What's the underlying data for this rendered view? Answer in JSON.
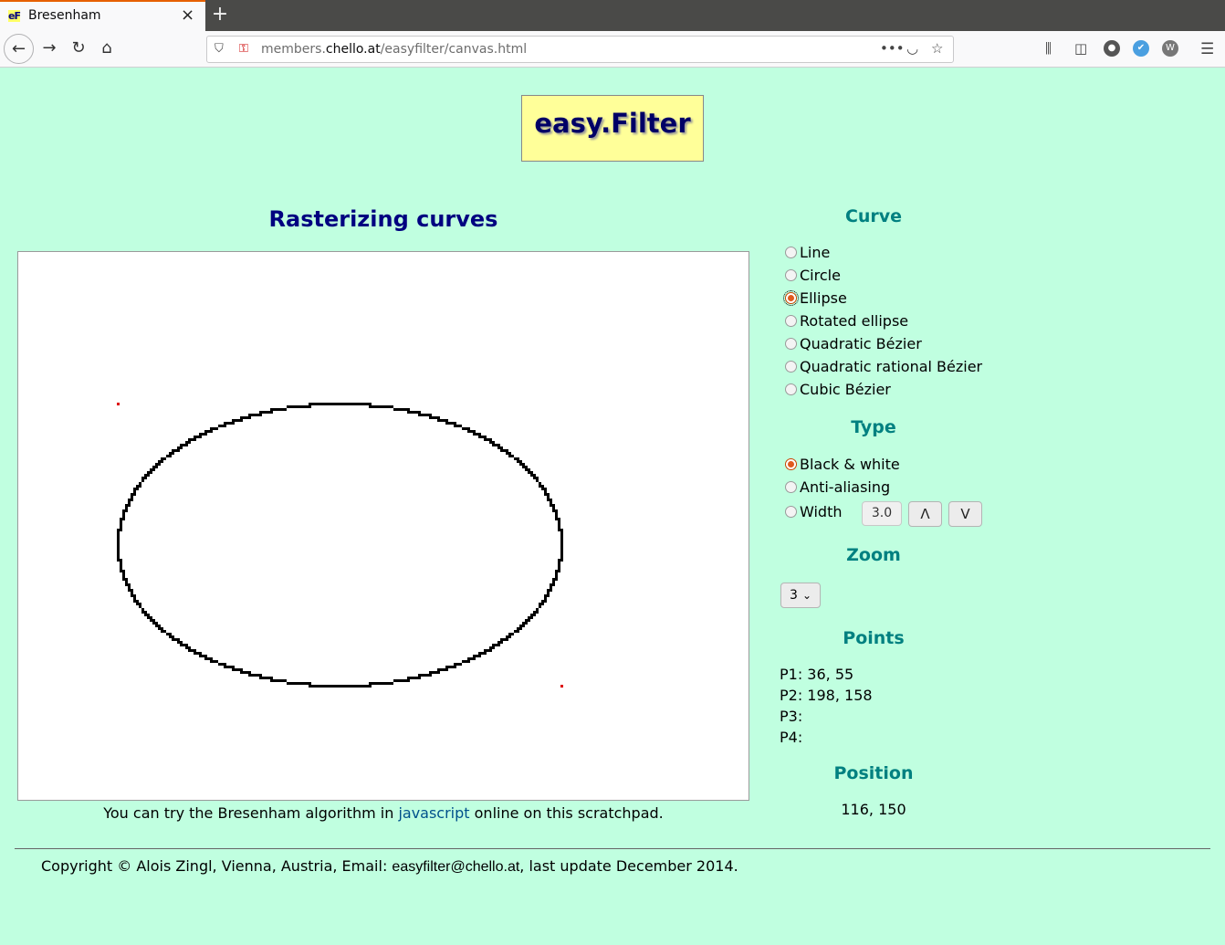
{
  "browser": {
    "tab_title": "Bresenham",
    "favicon": "eF",
    "url_prefix": "members.",
    "url_domain": "chello.at",
    "url_path": "/easyfilter/canvas.html",
    "icons": [
      "back-icon",
      "forward-icon",
      "reload-icon",
      "home-icon",
      "shield-icon",
      "insecure-lock-icon",
      "more-icon",
      "pocket-icon",
      "star-icon",
      "library-icon",
      "sidebar-icon",
      "account-icon",
      "extension-icon",
      "menu-icon"
    ]
  },
  "logo": {
    "text": "easy.Filter"
  },
  "main": {
    "heading": "Rasterizing curves",
    "caption_before": "You can try the Bresenham algorithm in ",
    "caption_link": "javascript",
    "caption_after": " online on this scratchpad."
  },
  "panel": {
    "curve_title": "Curve",
    "curves": [
      {
        "label": "Line",
        "selected": false
      },
      {
        "label": "Circle",
        "selected": false
      },
      {
        "label": "Ellipse",
        "selected": true
      },
      {
        "label": "Rotated ellipse",
        "selected": false
      },
      {
        "label": "Quadratic Bézier",
        "selected": false
      },
      {
        "label": "Quadratic rational Bézier",
        "selected": false
      },
      {
        "label": "Cubic Bézier",
        "selected": false
      }
    ],
    "type_title": "Type",
    "types": [
      {
        "label": "Black & white",
        "selected": true
      },
      {
        "label": "Anti-aliasing",
        "selected": false
      },
      {
        "label": "Width",
        "selected": false
      }
    ],
    "width_value": "3.0",
    "up_label": "Λ",
    "down_label": "V",
    "zoom_title": "Zoom",
    "zoom_value": "3",
    "points_title": "Points",
    "p1": "P1: 36, 55",
    "p2": "P2: 198, 158",
    "p3": "P3:",
    "p4": "P4:",
    "position_title": "Position",
    "position": "116, 150"
  },
  "footer": {
    "before": "Copyright © Alois Zingl, Vienna, Austria, Email: ",
    "email": "easyfilter@chello.at",
    "after": ", last update December 2014."
  },
  "colors": {
    "background": "#c0ffe0",
    "heading": "#000080",
    "section": "#008080",
    "logo_bg": "#ffff99",
    "point_marker": "#dd0000"
  }
}
